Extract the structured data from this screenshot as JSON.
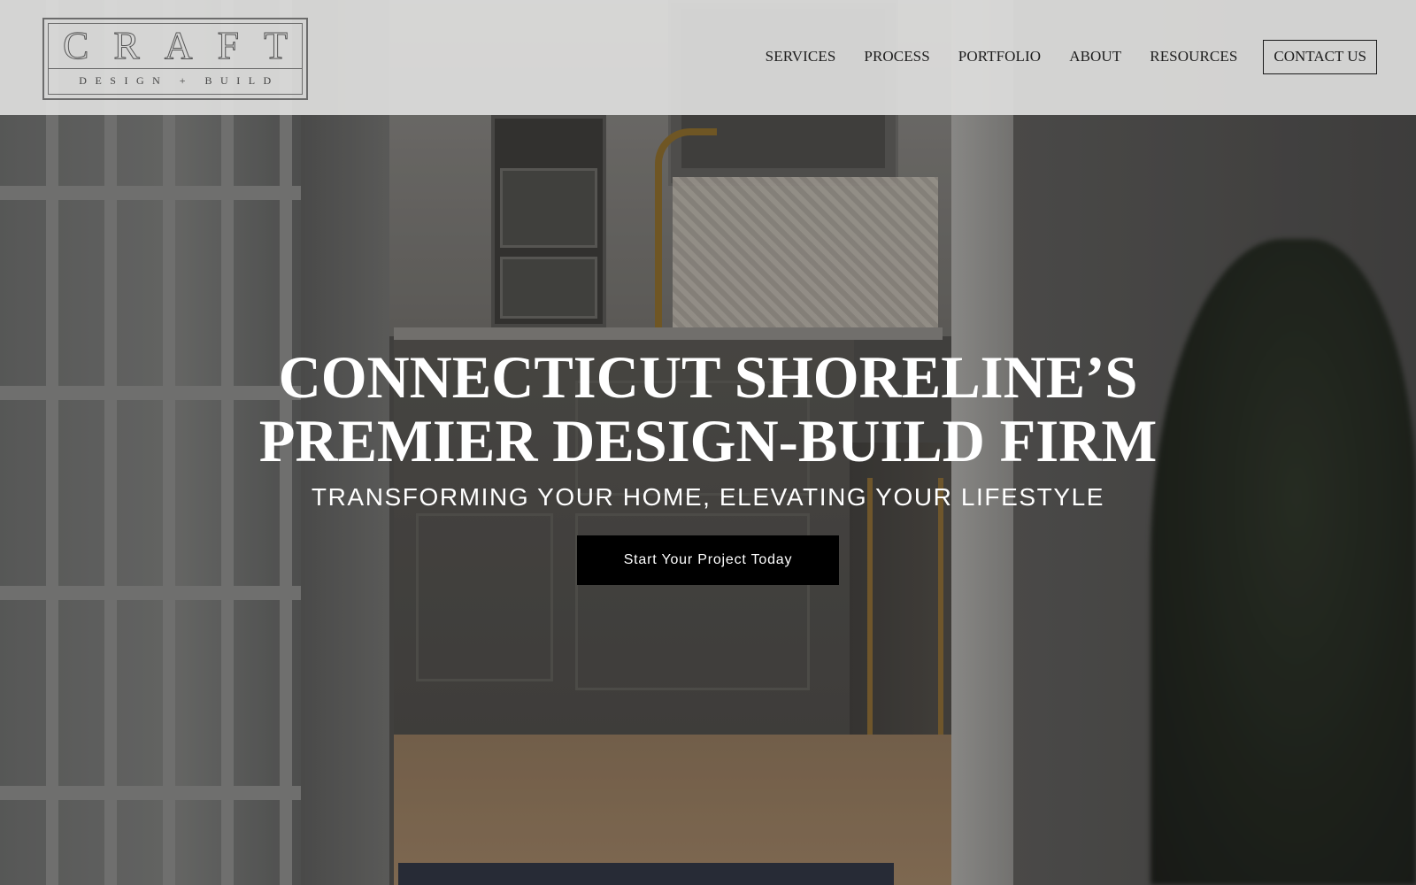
{
  "logo": {
    "letters": [
      "C",
      "R",
      "A",
      "F",
      "T"
    ],
    "tagline": "DESIGN + BUILD"
  },
  "nav": {
    "items": [
      {
        "label": "SERVICES"
      },
      {
        "label": "PROCESS"
      },
      {
        "label": "PORTFOLIO"
      },
      {
        "label": "ABOUT"
      },
      {
        "label": "RESOURCES"
      }
    ],
    "contact_label": "CONTACT US"
  },
  "hero": {
    "title_line1": "CONNECTICUT SHORELINE’S",
    "title_line2": "PREMIER DESIGN-BUILD FIRM",
    "subtitle": "TRANSFORMING YOUR HOME, ELEVATING YOUR LIFESTYLE",
    "cta_label": "Start Your Project Today"
  },
  "colors": {
    "header_bg": "#dededd",
    "cta_bg": "#000000",
    "hero_text": "#ffffff"
  }
}
